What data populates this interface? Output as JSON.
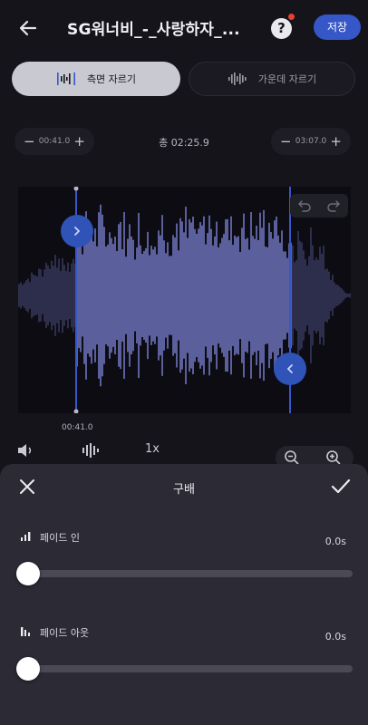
{
  "header": {
    "title": "SG워너비_-_사랑하자_...",
    "help_label": "?",
    "save_label": "저장"
  },
  "modes": [
    {
      "label": "측면 자르기",
      "active": true
    },
    {
      "label": "가운데 자르기",
      "active": false
    }
  ],
  "trim": {
    "start": "00:41.0",
    "end": "03:07.0",
    "total": "총 02:25.9",
    "minus": "−",
    "plus": "+",
    "start_marker": "00:41.0"
  },
  "toolbar": {
    "speed": "1x"
  },
  "sheet": {
    "title": "구배",
    "fade_in": {
      "label": "페이드 인",
      "value": "0.0s",
      "level": 0
    },
    "fade_out": {
      "label": "페이드 아웃",
      "value": "0.0s",
      "level": 0
    }
  },
  "colors": {
    "accent": "#3657c8",
    "waveform_selected": "#5b5f9c",
    "waveform_unselected": "#2c2e4c",
    "background": "#15141b",
    "sheet": "#2b2a35"
  }
}
